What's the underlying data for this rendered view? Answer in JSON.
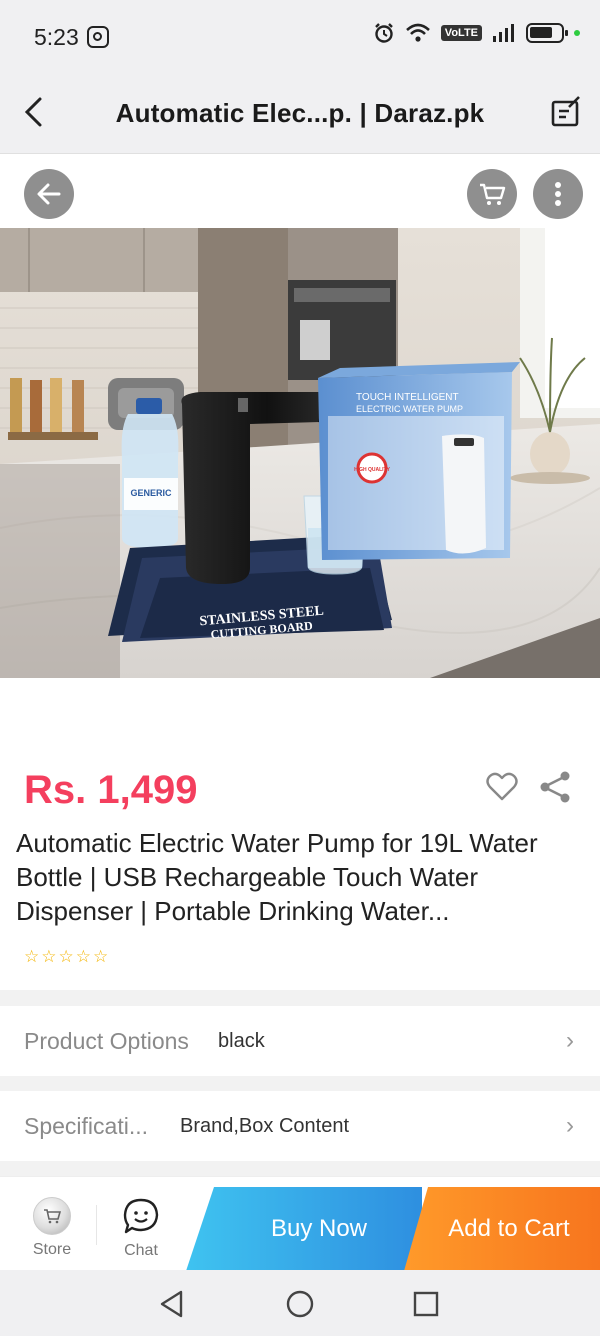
{
  "status_bar": {
    "time": "5:23",
    "volte_label": "VoLTE"
  },
  "header": {
    "title": "Automatic Elec...p. | Daraz.pk"
  },
  "product": {
    "price": "Rs. 1,499",
    "title": "Automatic Electric Water Pump for 19L Water Bottle | USB Rechargeable Touch Water Dispenser | Portable Drinking Water...",
    "rating_stars": 5,
    "rating_value": 0,
    "image_texts": {
      "box_line1": "TOUCH INTELLIGENT",
      "box_line2": "ELECTRIC WATER PUMP",
      "box_badge": "HIGH QUALITY",
      "bottle_label": "GENERIC",
      "board_line1": "STAINLESS STEEL",
      "board_line2": "CUTTING BOARD"
    }
  },
  "options": {
    "product_options_label": "Product Options",
    "product_options_value": "black",
    "specifications_label": "Specificati...",
    "specifications_value": "Brand,Box Content"
  },
  "bottom_bar": {
    "store_label": "Store",
    "chat_label": "Chat",
    "buy_now_label": "Buy Now",
    "add_to_cart_label": "Add to Cart"
  },
  "colors": {
    "price": "#f43f5e",
    "buy_now": "#2e8fe0",
    "add_to_cart": "#f7751e"
  },
  "icons": [
    "instagram-icon",
    "alarm-icon",
    "wifi-icon",
    "signal-icon",
    "battery-icon",
    "back-arrow-icon",
    "edit-icon",
    "cart-icon",
    "more-icon",
    "heart-icon",
    "share-icon",
    "chevron-right-icon",
    "chat-icon",
    "nav-back-icon",
    "nav-home-icon",
    "nav-recents-icon"
  ]
}
